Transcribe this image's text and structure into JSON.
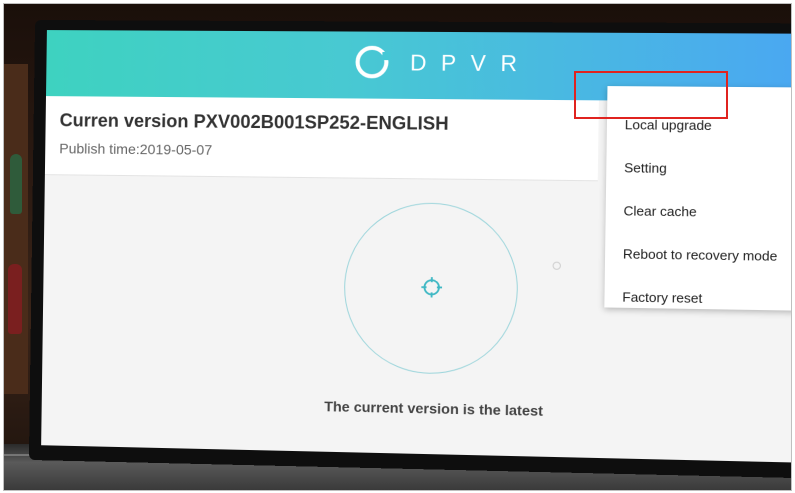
{
  "logo": {
    "text": "DPVR",
    "icon": "dpvr-logo-icon"
  },
  "version": {
    "title": "Curren version PXV002B001SP252-ENGLISH",
    "publish": "Publish time:2019-05-07"
  },
  "status": {
    "text": "The current version is the latest",
    "icon": "target-icon"
  },
  "menu": {
    "items": [
      {
        "label": "Local upgrade"
      },
      {
        "label": "Setting"
      },
      {
        "label": "Clear cache"
      },
      {
        "label": "Reboot to recovery mode"
      },
      {
        "label": "Factory reset"
      }
    ]
  },
  "colors": {
    "header_start": "#3ed2c0",
    "header_end": "#4aa7f2",
    "highlight": "#e0231f"
  }
}
